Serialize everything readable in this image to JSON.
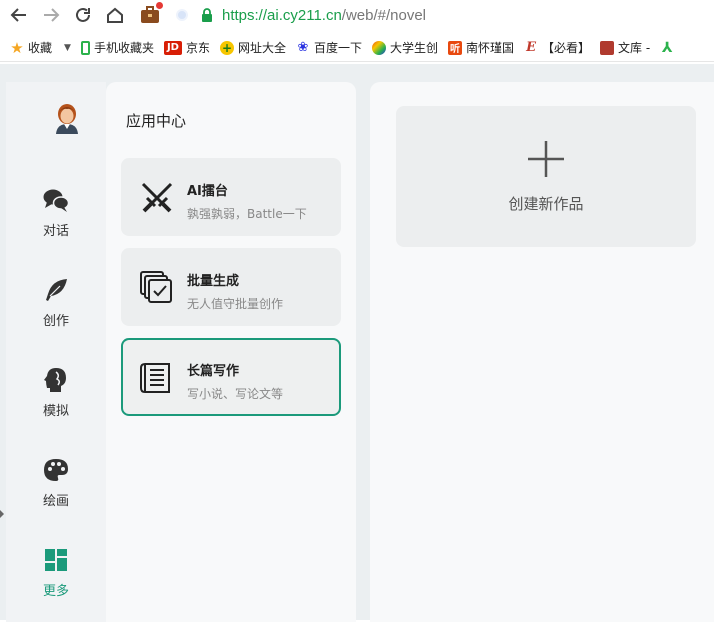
{
  "browser": {
    "url_scheme": "https://",
    "url_host": "ai.cy211.cn",
    "url_rest": "/web/#/novel"
  },
  "bookmarks": [
    {
      "label": "收藏",
      "icon": "star-icon",
      "color": "#f5a623"
    },
    {
      "label": "手机收藏夹",
      "icon": "phone-icon",
      "color": "#2bb24c"
    },
    {
      "label": "京东",
      "icon": "jd-icon",
      "color": "#d81e06"
    },
    {
      "label": "网址大全",
      "icon": "plus-circle-icon",
      "color": "#f7c600"
    },
    {
      "label": "百度一下",
      "icon": "baidu-paw-icon",
      "color": "#2932e1"
    },
    {
      "label": "大学生创",
      "icon": "colorful-icon",
      "color": "#e94e1b"
    },
    {
      "label": "南怀瑾国",
      "icon": "listen-icon",
      "color": "#e8490f"
    },
    {
      "label": "【必看】",
      "icon": "e-icon",
      "color": "#c0392b"
    },
    {
      "label": "文库 -",
      "icon": "wenku-icon",
      "color": "#b03a2e"
    }
  ],
  "rail": {
    "items": [
      {
        "label": "对话",
        "icon": "chat-bubbles-icon"
      },
      {
        "label": "创作",
        "icon": "feather-icon"
      },
      {
        "label": "模拟",
        "icon": "head-profile-icon"
      },
      {
        "label": "绘画",
        "icon": "palette-icon"
      },
      {
        "label": "更多",
        "icon": "grid-layout-icon"
      }
    ],
    "active_color": "#1b9a7b"
  },
  "panel": {
    "title": "应用中心",
    "cards": [
      {
        "title": "AI擂台",
        "subtitle": "孰强孰弱，Battle一下",
        "icon": "crossed-swords-icon"
      },
      {
        "title": "批量生成",
        "subtitle": "无人值守批量创作",
        "icon": "stacked-check-icon"
      },
      {
        "title": "长篇写作",
        "subtitle": "写小说、写论文等",
        "icon": "book-pages-icon"
      }
    ]
  },
  "main": {
    "new_work_label": "创建新作品"
  }
}
